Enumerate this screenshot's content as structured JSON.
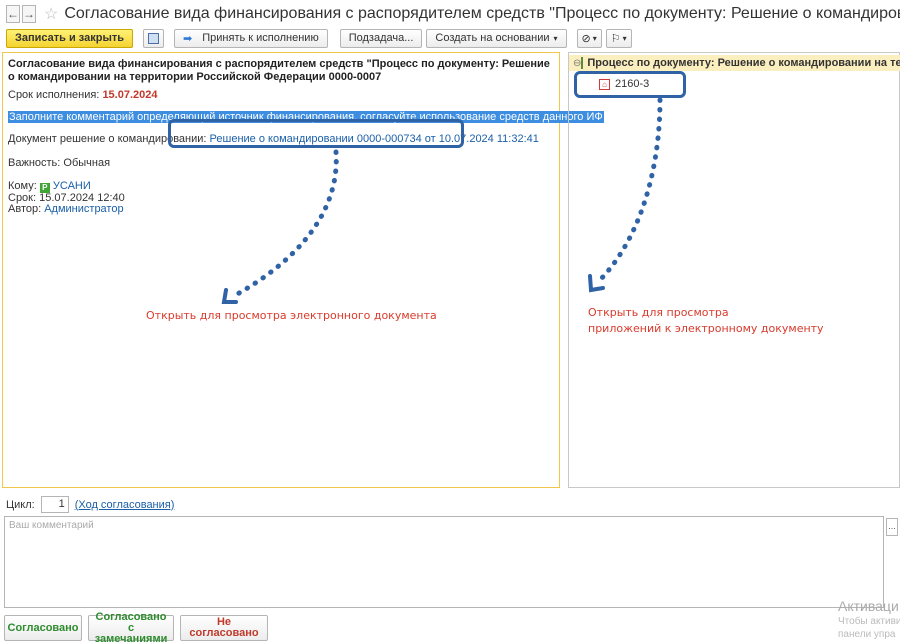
{
  "window": {
    "title": "Согласование вида финансирования с распорядителем средств \"Процесс по документу: Решение о командировании на территории Ро"
  },
  "toolbar": {
    "save_close": "Записать и закрыть",
    "accept": "Принять к исполнению",
    "subtask": "Подзадача...",
    "create_based": "Создать на основании"
  },
  "task": {
    "title": "Согласование вида финансирования с распорядителем средств \"Процесс по документу: Решение о командировании на территории Российской Федерации 0000-0007",
    "due_label": "Срок исполнения:",
    "due_value": "15.07.2024",
    "instruction": "Заполните комментарий определяющий источник финансирования, согласуйте использование средств данного ИФ",
    "doc_label": "Документ решение о командировании:",
    "doc_link": "Решение о командировании 0000-000734 от 10.07.2024 11:32:41",
    "importance_label": "Важность:",
    "importance_value": "Обычная",
    "to_label": "Кому:",
    "to_value": "УСАНИ",
    "deadline_label": "Срок:",
    "deadline_value": "15.07.2024 12:40",
    "author_label": "Автор:",
    "author_value": "Администратор"
  },
  "annotations": {
    "left_note": "Открыть для просмотра электронного документа",
    "right_note_line1": "Открыть для просмотра",
    "right_note_line2": "приложений к электронному документу"
  },
  "tree": {
    "root": "Процесс по документу: Решение о командировании на территории",
    "child": "2160-3"
  },
  "bottom": {
    "cycle_label": "Цикл:",
    "cycle_value": "1",
    "cycle_link": "(Ход согласования)",
    "comment_placeholder": "Ваш комментарий",
    "btn_approved": "Согласовано",
    "btn_approved_remarks_1": "Согласовано",
    "btn_approved_remarks_2": "с замечаниями",
    "btn_not_approved": "Не согласовано"
  },
  "watermark": {
    "line1": "Активаци",
    "line2": "Чтобы активи",
    "line3": "панели упра"
  },
  "colors": {
    "primary_button": "#f4d330",
    "accent_blue": "#2f63a6",
    "annotation_red": "#d93a2b",
    "approved_green": "#2e8b2e",
    "rejected_red": "#c0392b"
  }
}
